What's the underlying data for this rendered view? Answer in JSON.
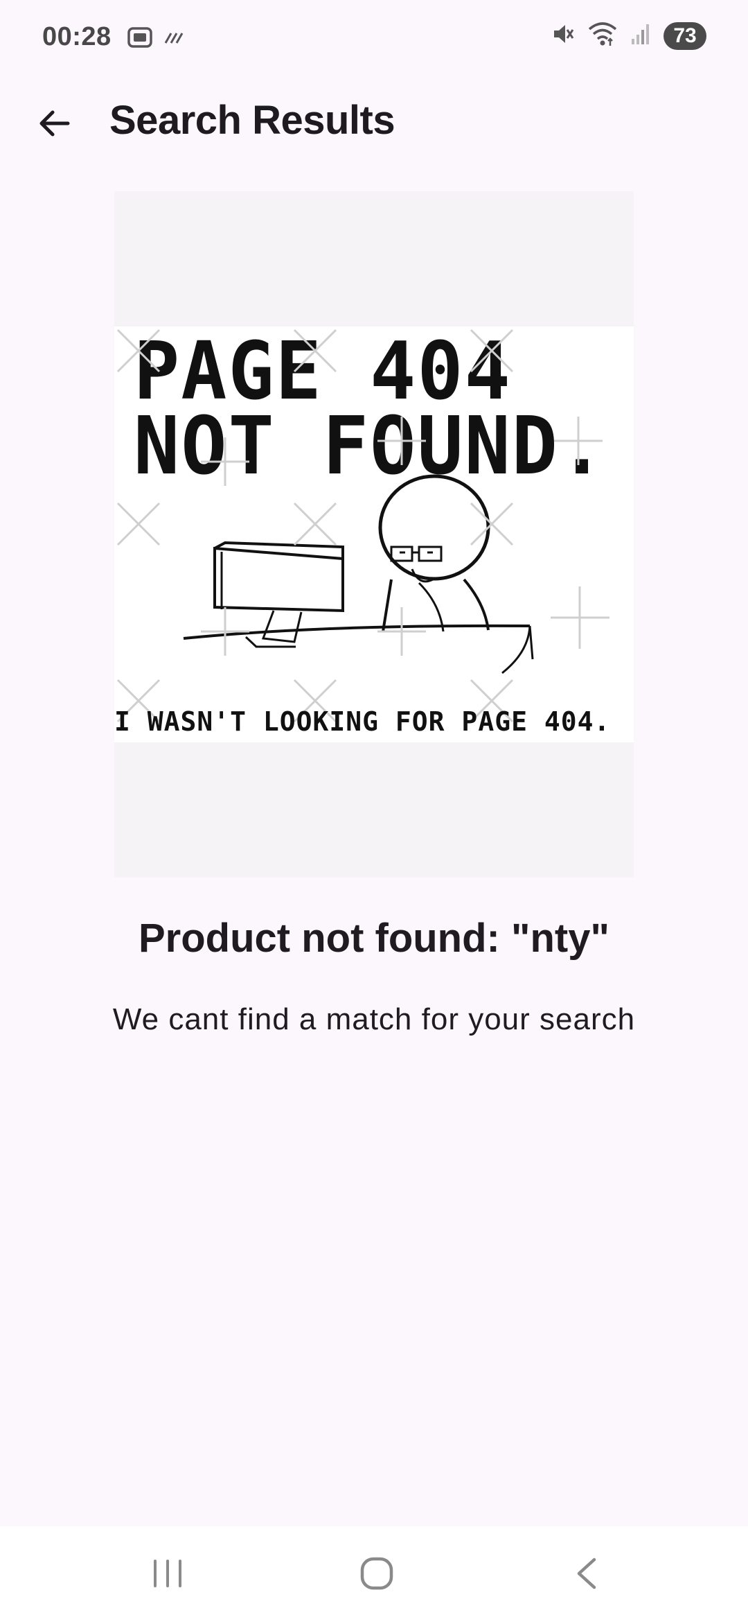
{
  "status_bar": {
    "time": "00:28",
    "battery": "73",
    "icons": [
      "screenshot-icon",
      "data-saver-icon",
      "mute-icon",
      "wifi-icon",
      "signal-icon"
    ]
  },
  "app_bar": {
    "title": "Search Results",
    "back_icon": "arrow-left-icon"
  },
  "illustration": {
    "headline_line1": "PAGE 404",
    "headline_line2": "NOT FOUND.",
    "caption": "I WASN'T LOOKING FOR PAGE 404."
  },
  "message": {
    "title": "Product not found: \"nty\"",
    "subtitle": "We cant find a match for your search"
  },
  "nav_bar": {
    "icons": [
      "recent-apps-icon",
      "home-icon",
      "back-icon"
    ]
  },
  "colors": {
    "background": "#fbf7fc",
    "text": "#1f1b20",
    "nav_background": "#ffffff"
  }
}
